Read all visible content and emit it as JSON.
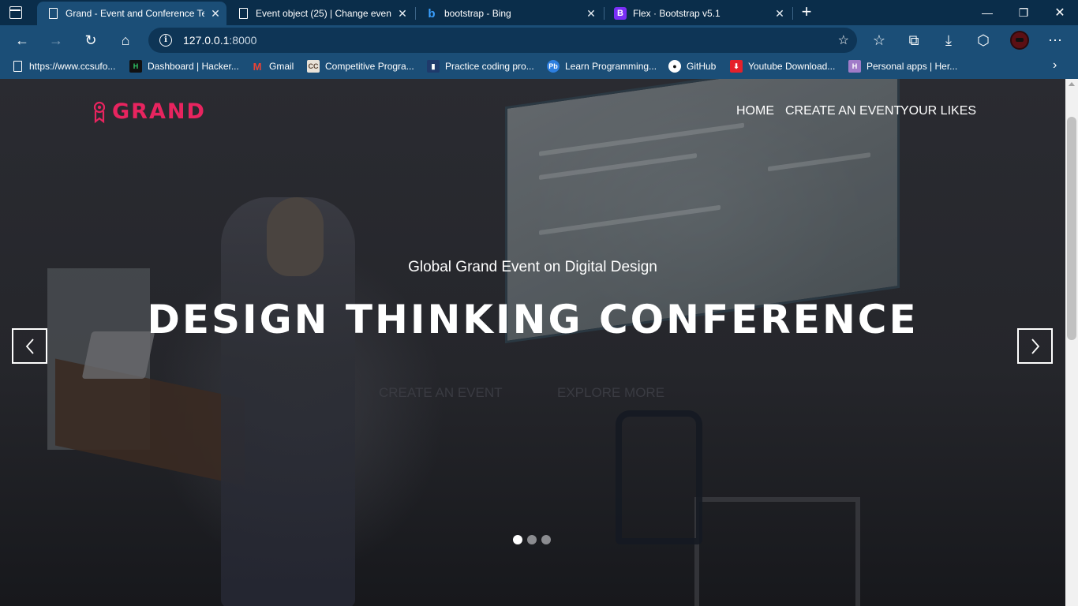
{
  "tabs": [
    {
      "title": "Grand - Event and Conference Te",
      "icon": "page-icon",
      "active": true
    },
    {
      "title": "Event object (25) | Change event",
      "icon": "page-icon",
      "active": false
    },
    {
      "title": "bootstrap - Bing",
      "icon": "bing-icon",
      "active": false
    },
    {
      "title": "Flex · Bootstrap v5.1",
      "icon": "bootstrap-icon",
      "active": false
    }
  ],
  "address": {
    "host": "127.0.0.1",
    "port": ":8000"
  },
  "bookmarks": [
    {
      "label": "https://www.ccsufo...",
      "icon": "page-icon"
    },
    {
      "label": "Dashboard | Hacker...",
      "icon": "hackerrank-icon"
    },
    {
      "label": "Gmail",
      "icon": "gmail-icon"
    },
    {
      "label": "Competitive Progra...",
      "icon": "codechef-icon"
    },
    {
      "label": "Practice coding pro...",
      "icon": "codeforces-icon"
    },
    {
      "label": "Learn Programming...",
      "icon": "programiz-icon"
    },
    {
      "label": "GitHub",
      "icon": "github-icon"
    },
    {
      "label": "Youtube Download...",
      "icon": "download-icon"
    },
    {
      "label": "Personal apps | Her...",
      "icon": "heroku-icon"
    }
  ],
  "site": {
    "brand": "GRAND",
    "menu": [
      "HOME",
      "CREATE AN EVENT",
      "YOUR LIKES"
    ],
    "subtitle": "Global Grand Event on Digital Design",
    "headline": "DESIGN THINKING CONFERENCE",
    "buttons": [
      "CREATE AN EVENT",
      "EXPLORE MORE"
    ]
  },
  "carousel": {
    "active_slide": 0,
    "slide_count": 3
  },
  "colors": {
    "brand_accent": "#e8245f",
    "chrome": "#1b4e77",
    "tabbar": "#0a2d4a"
  }
}
